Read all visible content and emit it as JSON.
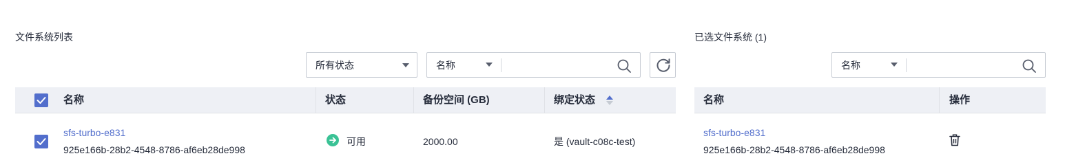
{
  "left": {
    "title": "文件系统列表",
    "status_filter": {
      "selected": "所有状态"
    },
    "search": {
      "field_selected": "名称",
      "value": ""
    },
    "columns": {
      "name": "名称",
      "status": "状态",
      "backup_space": "备份空间 (GB)",
      "bind_status": "绑定状态"
    },
    "rows": [
      {
        "checked": true,
        "name": "sfs-turbo-e831",
        "id": "925e166b-28b2-4548-8786-af6eb28de998",
        "status": "可用",
        "backup_space": "2000.00",
        "bind_status": "是 (vault-c08c-test)"
      }
    ]
  },
  "right": {
    "title": "已选文件系统 (1)",
    "search": {
      "field_selected": "名称",
      "value": ""
    },
    "columns": {
      "name": "名称",
      "action": "操作"
    },
    "rows": [
      {
        "name": "sfs-turbo-e831",
        "id": "925e166b-28b2-4548-8786-af6eb28de998"
      }
    ]
  },
  "icons": {
    "search": "search-icon",
    "refresh": "refresh-icon",
    "dropdown": "chevron-down-icon",
    "sort": "sort-icon",
    "status_available": "arrow-right-circle-icon",
    "delete": "trash-icon",
    "check": "check-icon"
  },
  "colors": {
    "accent": "#526ecc",
    "status_available": "#3ac295",
    "header_bg": "#eef0f5",
    "border": "#c6cbd3",
    "text": "#252b3a"
  }
}
